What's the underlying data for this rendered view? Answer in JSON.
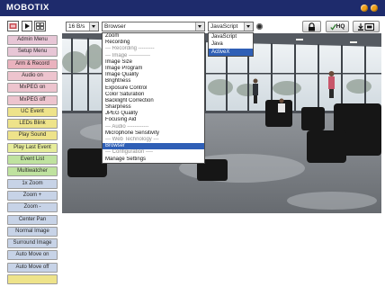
{
  "header": {
    "brand": "MOBOTIX",
    "background": "#1e2b6c",
    "icon_color": "#f0a018",
    "icons": [
      "help-icon",
      "info-icon"
    ]
  },
  "toolbar": {
    "view_icons": [
      "live-image-icon",
      "play-icon",
      "multiview-icon"
    ],
    "frame_rate": {
      "value": "16 B/s"
    },
    "quick_control": {
      "value": "Browser",
      "options": [
        {
          "label": "Zoom"
        },
        {
          "label": "Recording"
        },
        {
          "label": "--- Recording ---------",
          "separator": true
        },
        {
          "label": "--- Image ------------",
          "separator": true
        },
        {
          "label": "Image Size"
        },
        {
          "label": "Image Program"
        },
        {
          "label": "Image Quality"
        },
        {
          "label": "Brightness"
        },
        {
          "label": "Exposure Control"
        },
        {
          "label": "Color Saturation"
        },
        {
          "label": "Backlight Correction"
        },
        {
          "label": "Sharpness"
        },
        {
          "label": "JPEG Quality"
        },
        {
          "label": "Focusing Aid"
        },
        {
          "label": "--- Audio ------------",
          "separator": true
        },
        {
          "label": "Microphone Sensitivity"
        },
        {
          "label": "--- Web Technology ---",
          "separator": true
        },
        {
          "label": "Browser",
          "highlighted": true
        },
        {
          "label": "--- Configuration ----",
          "separator": true
        },
        {
          "label": "Manage Settings"
        }
      ]
    },
    "technology": {
      "value": "JavaScript",
      "options": [
        {
          "label": "JavaScript"
        },
        {
          "label": "Java"
        },
        {
          "label": "ActiveX",
          "highlighted": true
        }
      ]
    },
    "highlight_color": "#2f5fb6",
    "status_icon": "indicator-icon",
    "buttons": {
      "lock_icon": "lock-icon",
      "hq": {
        "icon": "checkmark-icon",
        "label": "HQ"
      },
      "save_icon": "save-image-icon"
    }
  },
  "sidebar": {
    "buttons": [
      {
        "label": "Admin Menu",
        "color": "#e7c6d6"
      },
      {
        "label": "Setup Menu",
        "color": "#e7c6d6"
      },
      {
        "label": "Arm & Record",
        "color": "#eab2be"
      },
      {
        "label": "Audio on",
        "color": "#edc4ce"
      },
      {
        "label": "MxPEG on",
        "color": "#edc4ce"
      },
      {
        "label": "MxPEG off",
        "color": "#edc4ce"
      },
      {
        "label": "UC Event",
        "color": "#eee38a"
      },
      {
        "label": "LEDs Blink",
        "color": "#eee38a"
      },
      {
        "label": "Play Sound",
        "color": "#eee38a"
      },
      {
        "label": "Play Last Event",
        "color": "#e6ec9a"
      },
      {
        "label": "Event List",
        "color": "#bfe29f"
      },
      {
        "label": "Multiwatcher",
        "color": "#bfe29f"
      },
      {
        "label": "1x Zoom",
        "color": "#c7d3e7"
      },
      {
        "label": "Zoom +",
        "color": "#c7d3e7"
      },
      {
        "label": "Zoom -",
        "color": "#c7d3e7"
      },
      {
        "label": "Center Pan",
        "color": "#c7d3e7"
      },
      {
        "label": "Normal Image",
        "color": "#c7d3e7"
      },
      {
        "label": "Surround Image",
        "color": "#c7d3e7"
      },
      {
        "label": "Auto Move on",
        "color": "#c7d3e7"
      },
      {
        "label": "Auto Move off",
        "color": "#c7d3e7"
      },
      {
        "label": "",
        "color": "#eee38a"
      }
    ]
  }
}
